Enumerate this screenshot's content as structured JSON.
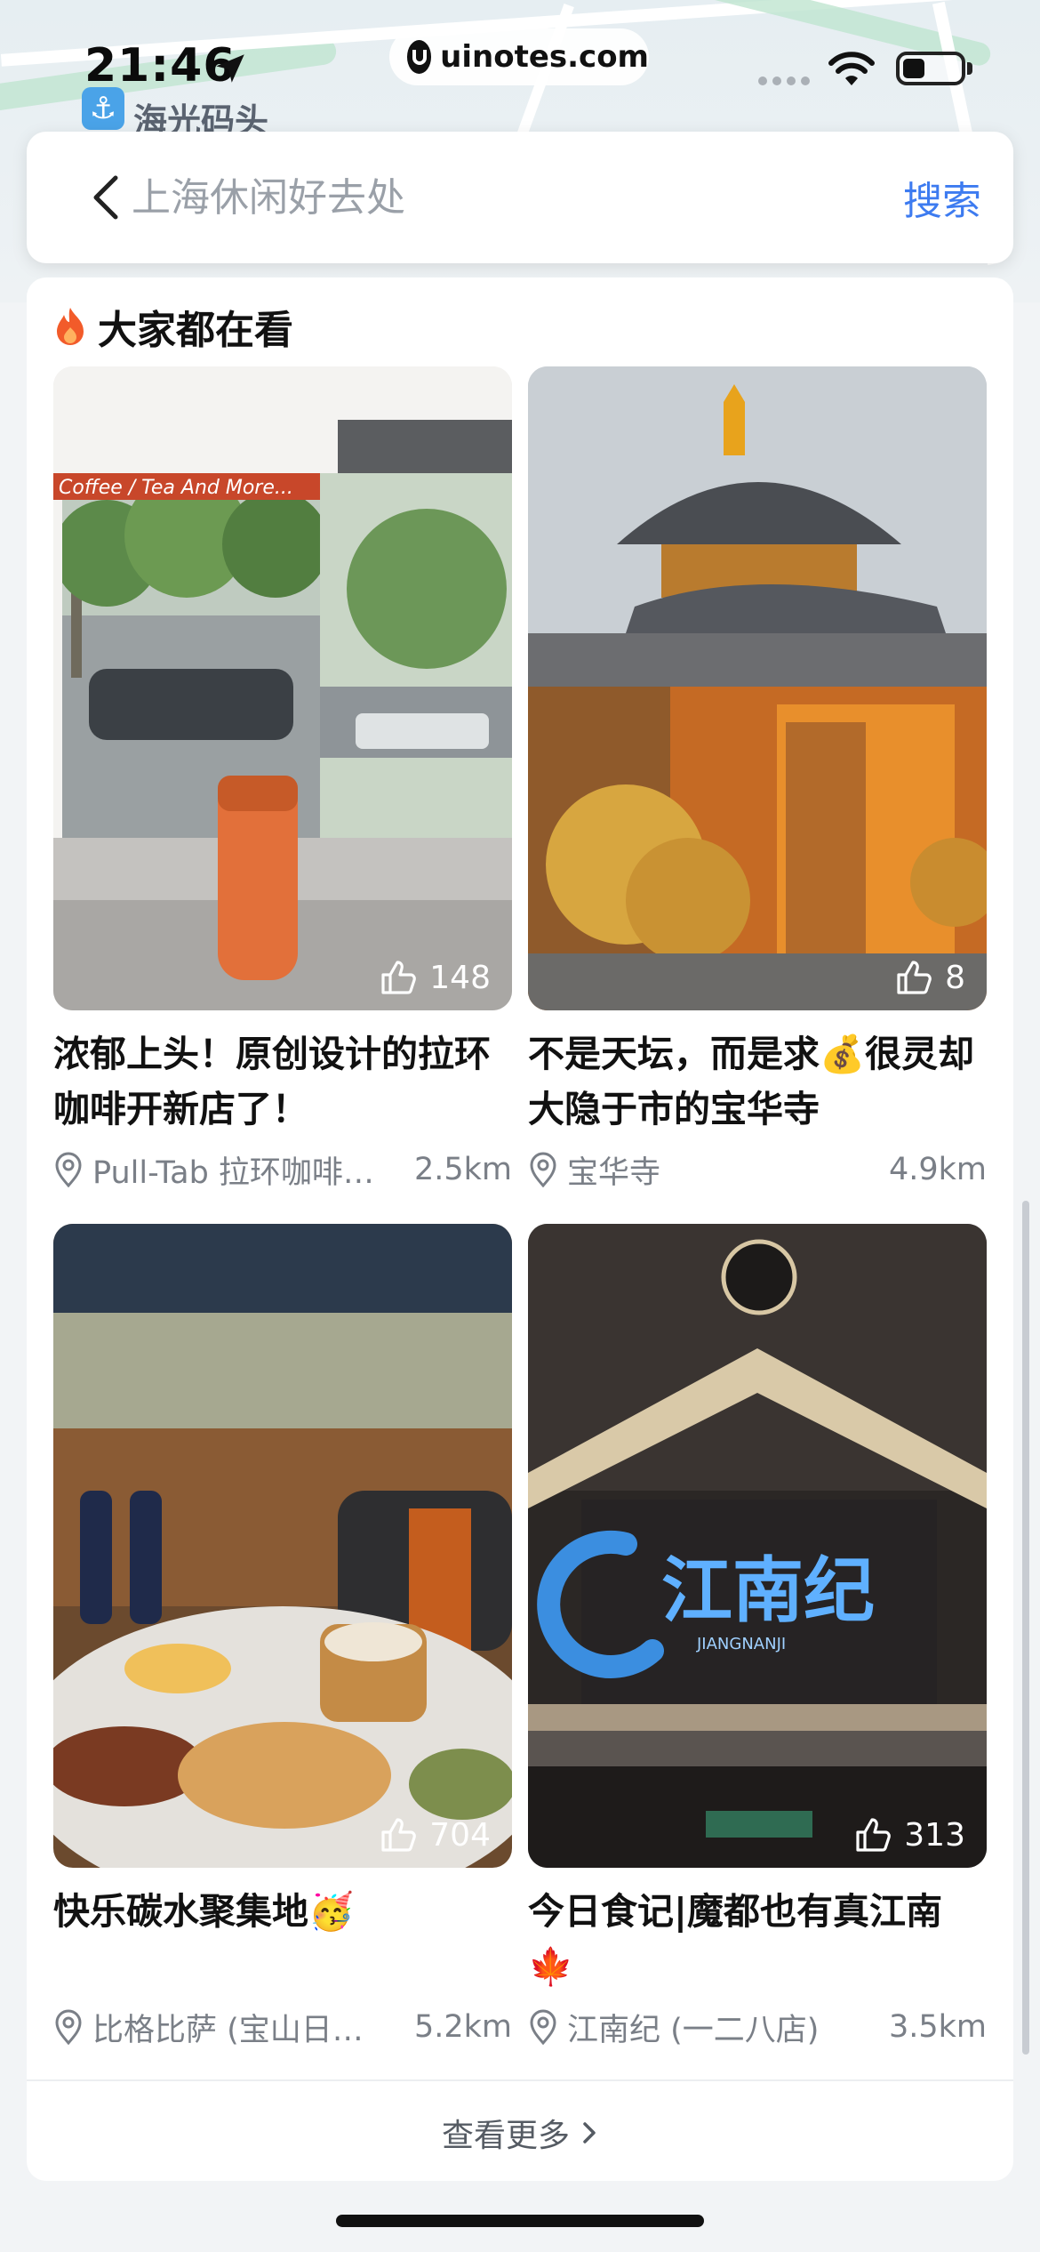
{
  "status_bar": {
    "time": "21:46",
    "url": "uinotes.com"
  },
  "map": {
    "place_label": "海光码头"
  },
  "search": {
    "placeholder": "上海休闲好去处",
    "search_label": "搜索"
  },
  "section": {
    "title": "大家都在看"
  },
  "feed": [
    {
      "likes": "148",
      "title": "浓郁上头！原创设计的拉环咖啡开新店了！",
      "location": "Pull-Tab 拉环咖啡…",
      "distance": "2.5km"
    },
    {
      "likes": "8",
      "title": "不是天坛，而是求💰很灵却大隐于市的宝华寺",
      "location": "宝华寺",
      "distance": "4.9km"
    },
    {
      "likes": "704",
      "title": "快乐碳水聚集地🥳",
      "location": "比格比萨 (宝山日…",
      "distance": "5.2km"
    },
    {
      "likes": "313",
      "title": "今日食记|魔都也有真江南🍁",
      "location": "江南纪 (一二八店)",
      "distance": "3.5km"
    }
  ],
  "image_text": {
    "coffee_sign": "Coffee / Tea And More...",
    "restaurant_name": "江南纪",
    "restaurant_pinyin": "JIANGNANJI"
  },
  "footer": {
    "more_label": "查看更多"
  },
  "colors": {
    "accent": "#3d7bf0",
    "fire": "#f25b2a"
  }
}
